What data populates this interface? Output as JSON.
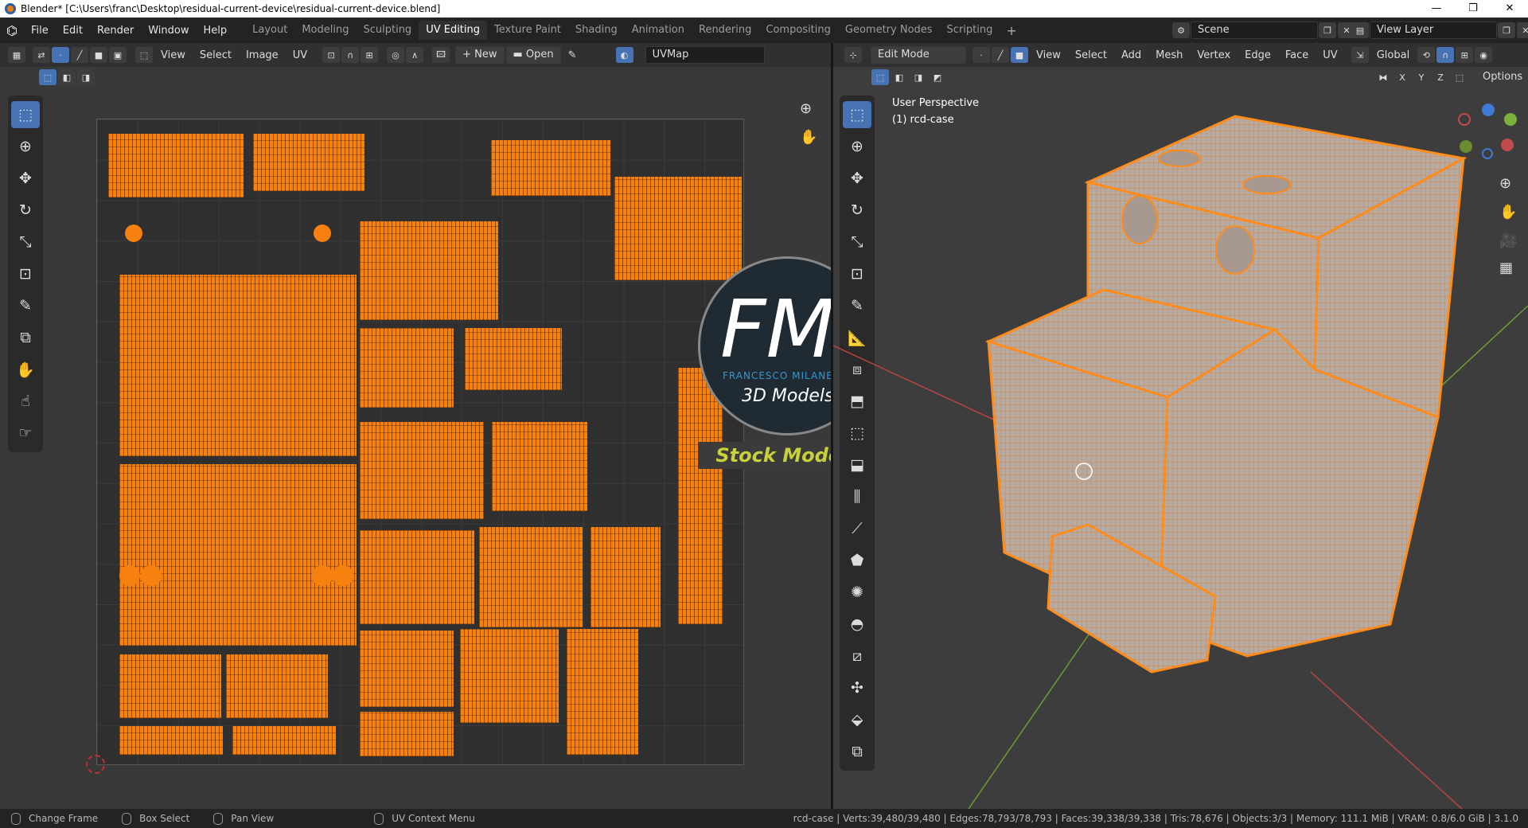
{
  "window": {
    "title": "Blender* [C:\\Users\\franc\\Desktop\\residual-current-device\\residual-current-device.blend]",
    "controls": [
      "—",
      "❐",
      "✕"
    ]
  },
  "menu": [
    "File",
    "Edit",
    "Render",
    "Window",
    "Help"
  ],
  "workspaces": [
    "Layout",
    "Modeling",
    "Sculpting",
    "UV Editing",
    "Texture Paint",
    "Shading",
    "Animation",
    "Rendering",
    "Compositing",
    "Geometry Nodes",
    "Scripting"
  ],
  "active_workspace": "UV Editing",
  "scene": {
    "label": "Scene",
    "view_layer": "View Layer"
  },
  "uv_editor": {
    "menus": [
      "View",
      "Select",
      "Image",
      "UV"
    ],
    "new_label": "New",
    "open_label": "Open",
    "uvmap": "UVMap"
  },
  "viewport": {
    "mode": "Edit Mode",
    "menus": [
      "View",
      "Select",
      "Add",
      "Mesh",
      "Vertex",
      "Edge",
      "Face",
      "UV"
    ],
    "orientation": "Global",
    "axes": [
      "X",
      "Y",
      "Z"
    ],
    "options_label": "Options",
    "perspective": "User Perspective",
    "object": "(1) rcd-case"
  },
  "overlay": {
    "fm": "FM",
    "author": "FRANCESCO MILANESE",
    "line1": "3D Models",
    "line2": "Stock Models"
  },
  "statusbar": {
    "change_frame": "Change Frame",
    "box_select": "Box Select",
    "pan_view": "Pan View",
    "uv_context": "UV Context Menu",
    "stats": "rcd-case | Verts:39,480/39,480 | Edges:78,793/78,793 | Faces:39,338/39,338 | Tris:78,676 | Objects:3/3 | Memory: 111.1 MiB | VRAM: 0.8/6.0 GiB | 3.1.0"
  },
  "colors": {
    "accent": "#4772b3",
    "uv_island": "#f7810e",
    "x_axis": "#c24a4a",
    "y_axis": "#7ab23a",
    "z_axis": "#3e7ad6"
  }
}
